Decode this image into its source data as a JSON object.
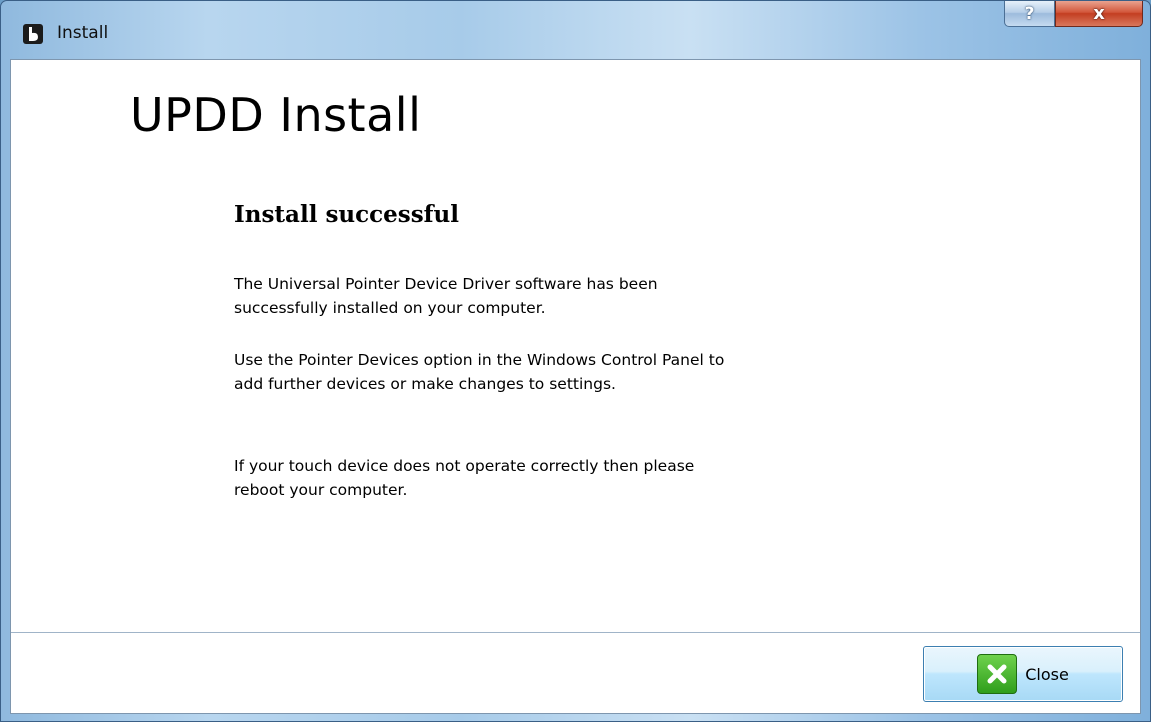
{
  "window": {
    "title": "Install",
    "help_label": "?",
    "close_label": "x"
  },
  "content": {
    "heading": "UPDD Install",
    "subheading": "Install successful",
    "paragraphs": [
      "The Universal Pointer Device Driver software has been\nsuccessfully installed on your computer.",
      "Use the Pointer Devices option in the Windows Control Panel  to\nadd further devices or make changes to settings.",
      "If your touch device does not operate correctly then please\nreboot your computer."
    ]
  },
  "footer": {
    "close_button_label": "Close"
  },
  "icons": {
    "app": "app-icon",
    "close_button": "green-x-icon"
  },
  "colors": {
    "title_close_red": "#c33e21",
    "button_blue": "#bee6fd",
    "icon_green": "#2f9e1c"
  }
}
